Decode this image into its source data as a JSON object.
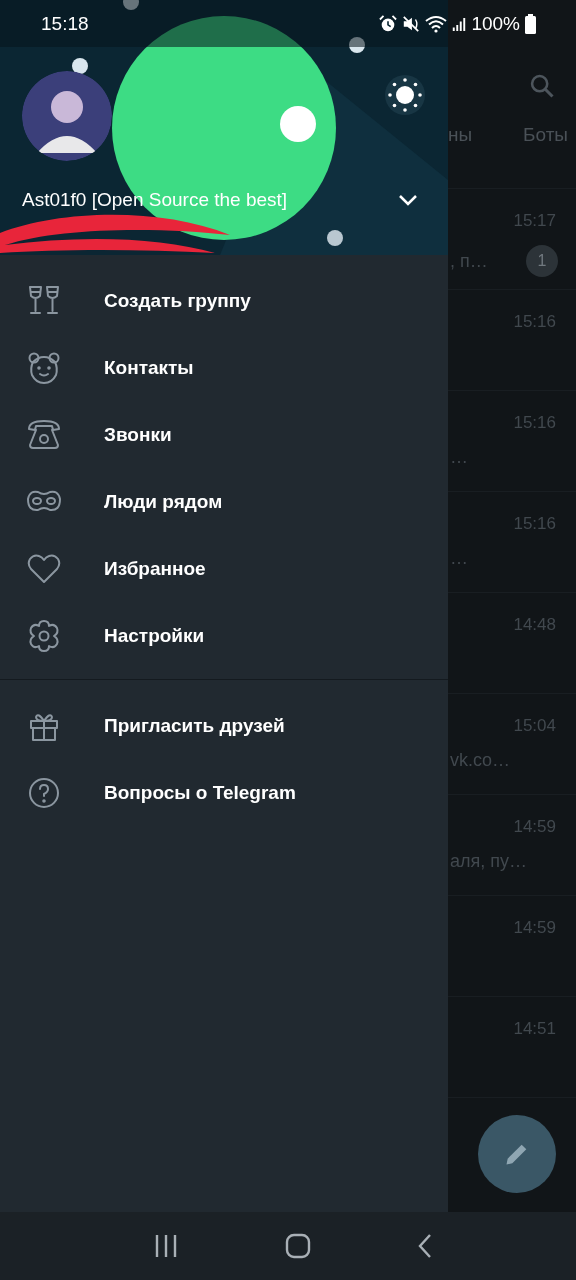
{
  "status_bar": {
    "time": "15:18",
    "battery": "100%"
  },
  "drawer": {
    "user_name": "Ast01f0 [Open Source the best]",
    "menu": [
      "Создать группу",
      "Контакты",
      "Звонки",
      "Люди рядом",
      "Избранное",
      "Настройки"
    ],
    "footer_menu": [
      "Пригласить друзей",
      "Вопросы о Telegram"
    ]
  },
  "chat_list": {
    "tabs": [
      "ны",
      "Боты"
    ],
    "rows": [
      {
        "time": "15:17",
        "snippet": ", п…",
        "unread": "1"
      },
      {
        "time": "15:16"
      },
      {
        "time": "15:16",
        "snippet": "…"
      },
      {
        "time": "15:16",
        "snippet": "…"
      },
      {
        "time": "14:48"
      },
      {
        "time": "15:04",
        "snippet": "vk.co…"
      },
      {
        "time": "14:59",
        "snippet": "аля, пу…"
      },
      {
        "time": "14:59"
      },
      {
        "time": "14:51"
      }
    ]
  }
}
